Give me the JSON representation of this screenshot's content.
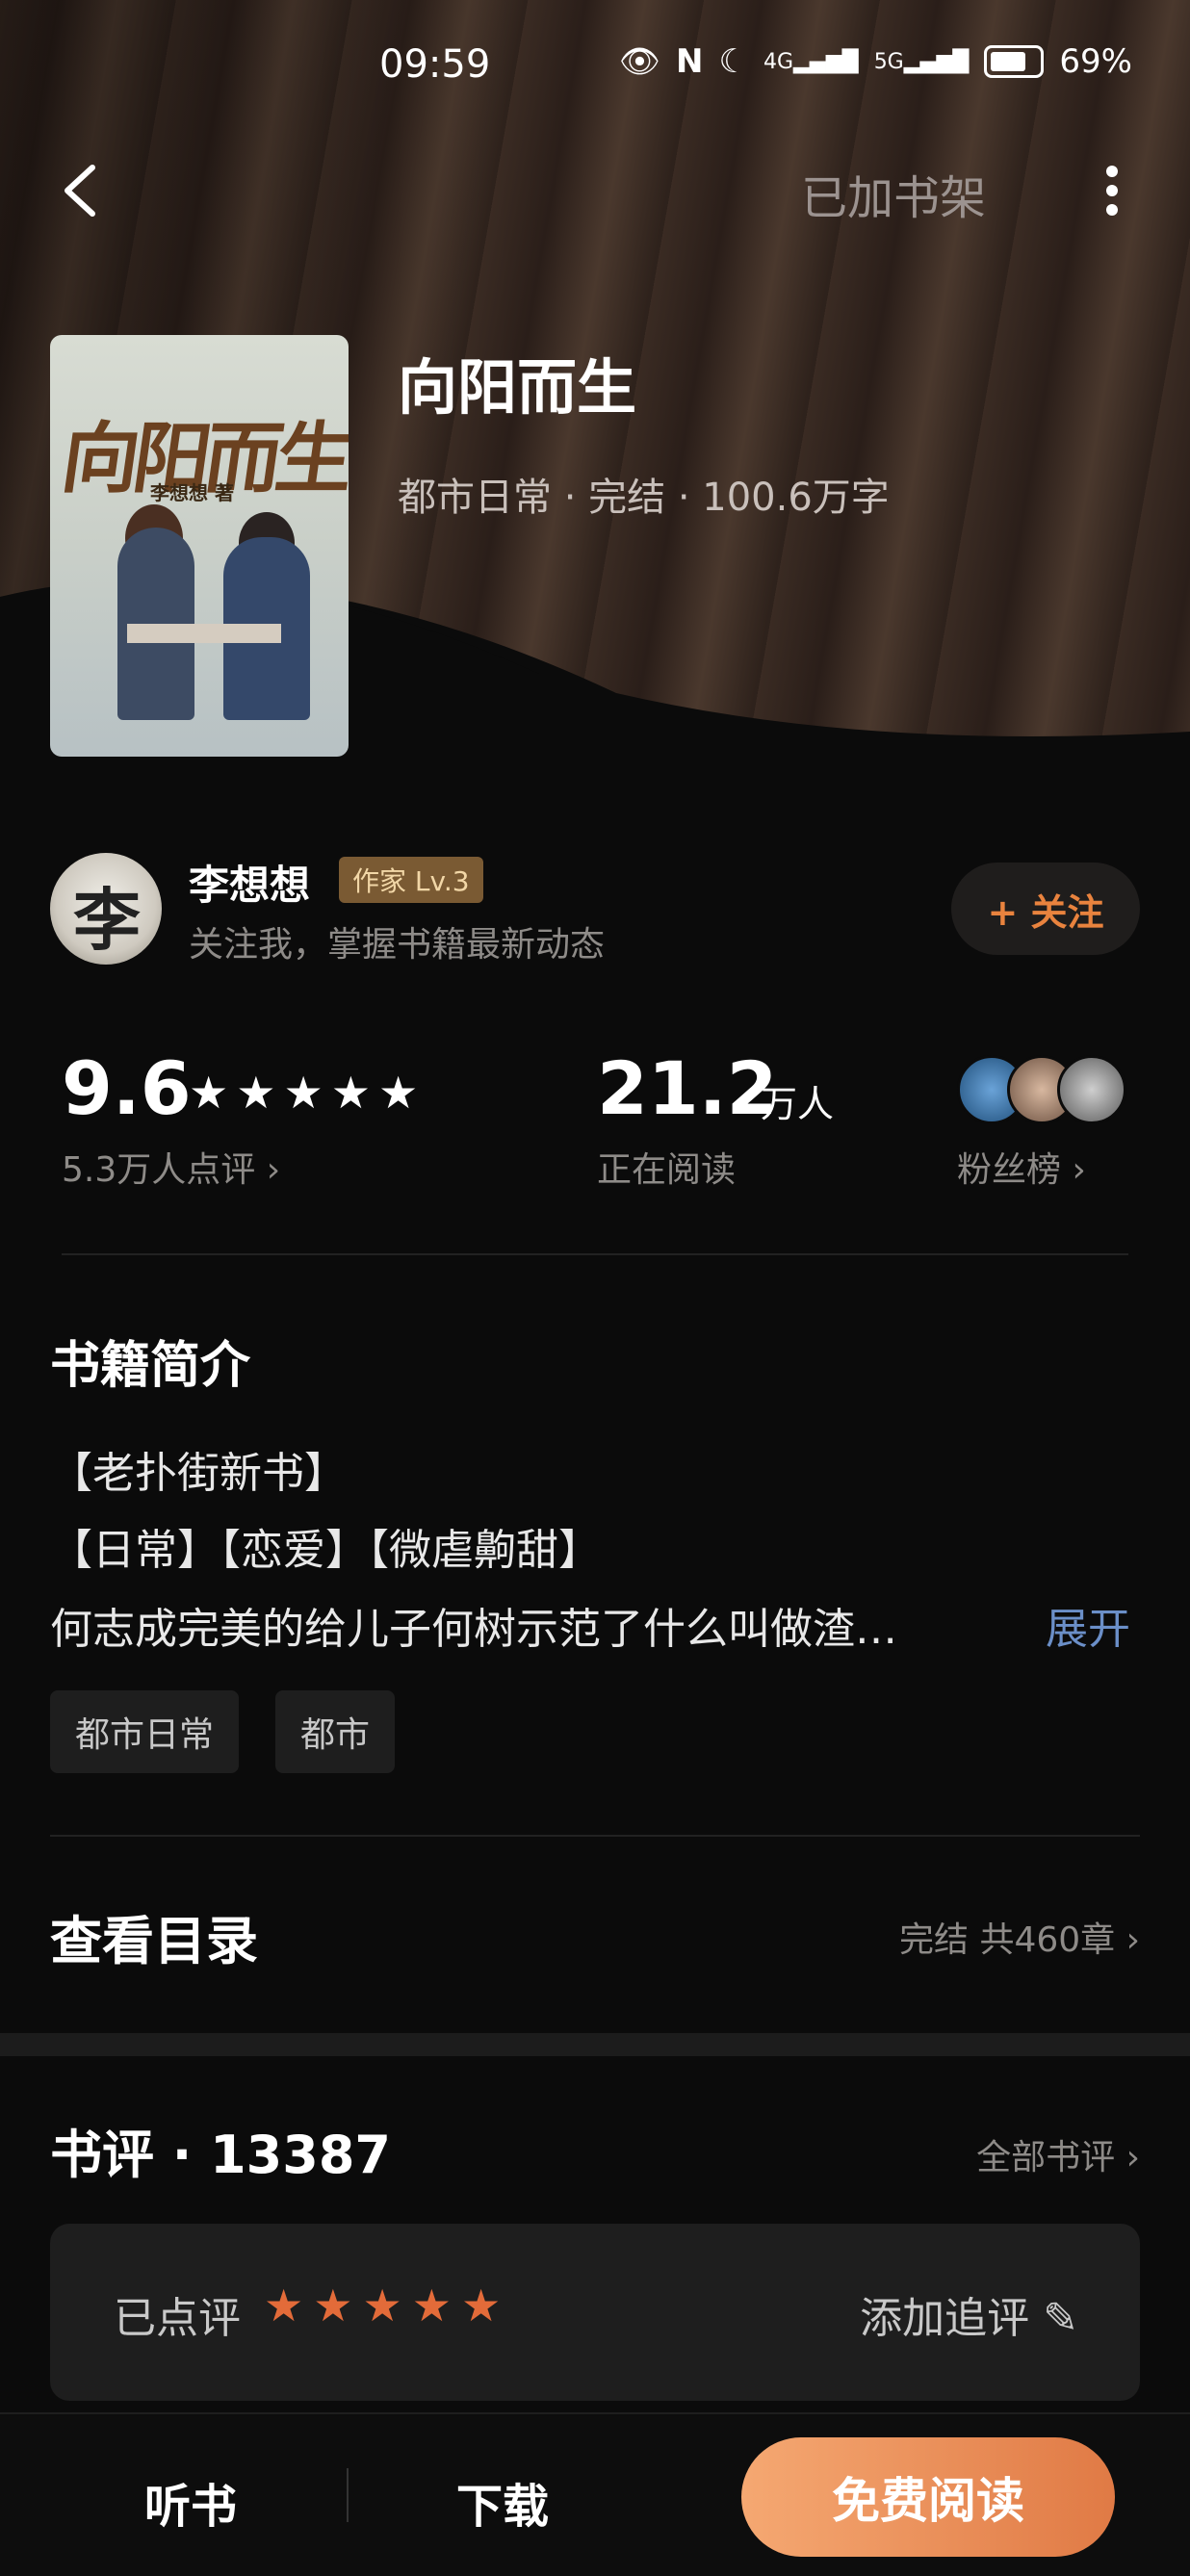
{
  "status": {
    "time": "09:59",
    "battery": "69%",
    "signal1": "4G",
    "signal2": "5G"
  },
  "topbar": {
    "shelf_label": "已加书架"
  },
  "book": {
    "cover_title": "向阳而生",
    "cover_author": "李想想 著",
    "title": "向阳而生",
    "meta": "都市日常 · 完结 · 100.6万字"
  },
  "author": {
    "avatar_char": "李",
    "name": "李想想",
    "badge": "作家 Lv.3",
    "subtitle": "关注我，掌握书籍最新动态",
    "follow_label": "+ 关注"
  },
  "stats": {
    "score": "9.6",
    "stars": "★★★★★",
    "score_sub": "5.3万人点评 ›",
    "reading": "21.2",
    "reading_unit": "万人",
    "reading_sub": "正在阅读",
    "fans_sub": "粉丝榜 ›"
  },
  "intro": {
    "title": "书籍简介",
    "lines": [
      "【老扑街新书】",
      "【日常】【恋爱】【微虐齁甜】",
      "何志成完美的给儿子何树示范了什么叫做渣…"
    ],
    "expand_label": "展开",
    "tags": [
      "都市日常",
      "都市"
    ]
  },
  "toc": {
    "title": "查看目录",
    "meta": "完结 共460章 ›"
  },
  "reviews": {
    "title": "书评 · 13387",
    "all_label": "全部书评 ›",
    "rated_label": "已点评",
    "rated_stars": "★★★★★",
    "add_label": "添加追评 ✎"
  },
  "bottom": {
    "listen": "听书",
    "download": "下载",
    "read": "免费阅读"
  },
  "colors": {
    "accent": "#e07a45",
    "link": "#6b8fc8",
    "background": "#0b0b0b"
  }
}
